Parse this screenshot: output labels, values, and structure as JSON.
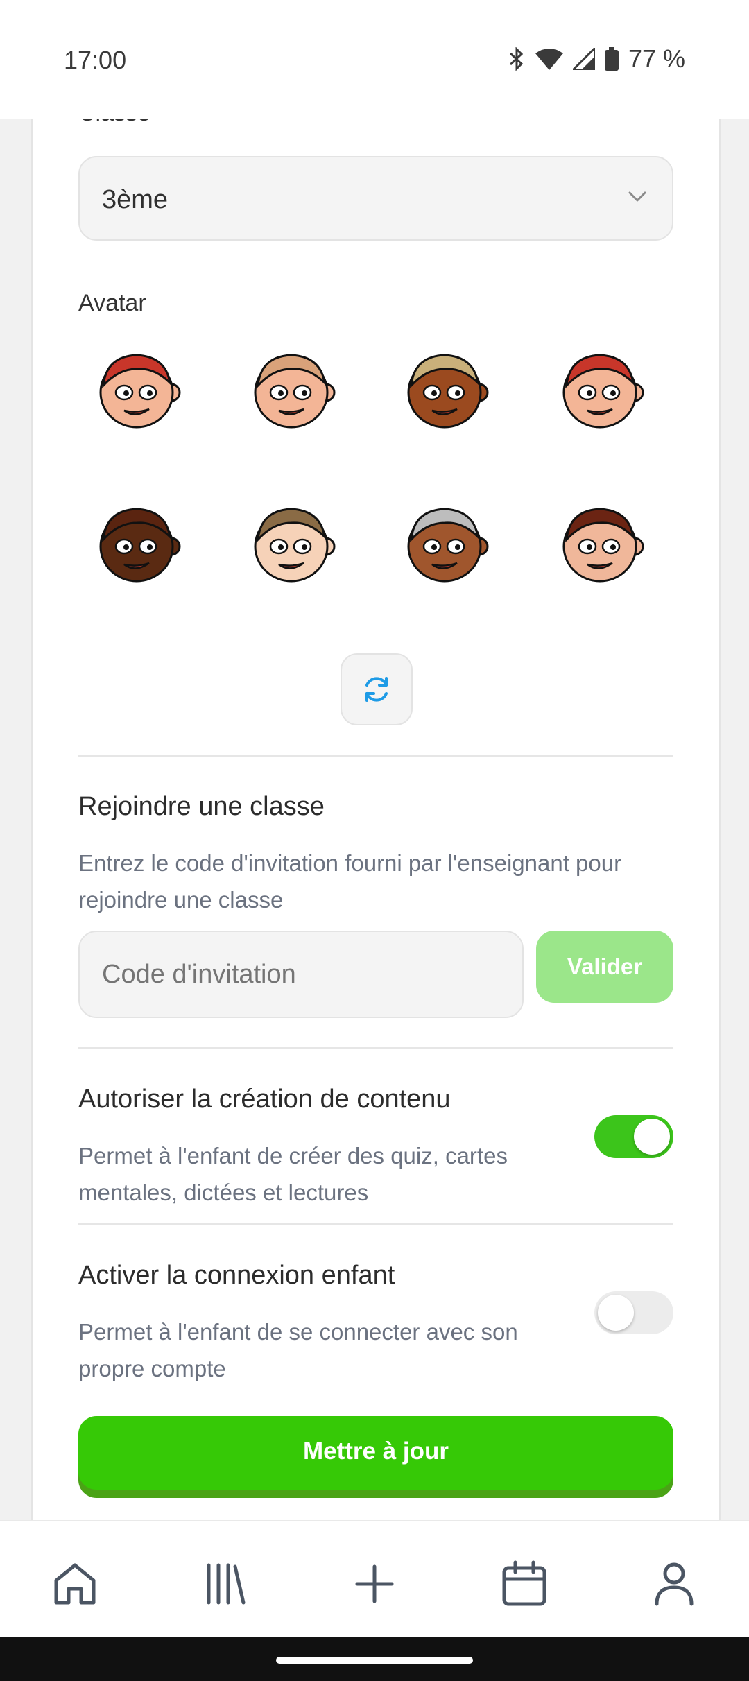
{
  "status_bar": {
    "time": "17:00",
    "battery": "77 %",
    "icons": [
      "bluetooth-icon",
      "wifi-icon",
      "signal-icon",
      "battery-icon"
    ]
  },
  "form": {
    "class_label": "Classe",
    "class_value": "3ème",
    "avatar_label": "Avatar",
    "avatars": [
      {
        "name": "avatar-red-hair-boy",
        "skin": "#f3b596",
        "hair": "#c8362a"
      },
      {
        "name": "avatar-bald-angry-boy",
        "skin": "#f3b596",
        "hair": "#d9a27a"
      },
      {
        "name": "avatar-blonde-dark-boy",
        "skin": "#9b4a1f",
        "hair": "#c9b07a"
      },
      {
        "name": "avatar-red-buns-girl",
        "skin": "#f3b596",
        "hair": "#c8362a"
      },
      {
        "name": "avatar-curly-dark-girl",
        "skin": "#5a2a12",
        "hair": "#5a2410"
      },
      {
        "name": "avatar-brown-hair-boy",
        "skin": "#f6d2b8",
        "hair": "#8a6b45"
      },
      {
        "name": "avatar-grey-hair-girl",
        "skin": "#a0562d",
        "hair": "#bdbdbd"
      },
      {
        "name": "avatar-brown-bob-girl",
        "skin": "#f0b79a",
        "hair": "#6b2413"
      }
    ],
    "refresh_icon": "refresh-icon"
  },
  "join_class": {
    "title": "Rejoindre une classe",
    "description": "Entrez le code d'invitation fourni par l'enseignant pour rejoindre une classe",
    "code_placeholder": "Code d'invitation",
    "validate_label": "Valider"
  },
  "settings": {
    "content_creation": {
      "title": "Autoriser la création de contenu",
      "description": "Permet à l'enfant de créer des quiz, cartes mentales, dictées et lectures",
      "enabled": true
    },
    "child_login": {
      "title": "Activer la connexion enfant",
      "description": "Permet à l'enfant de se connecter avec son propre compte",
      "enabled": false
    }
  },
  "update_label": "Mettre à jour",
  "bottom_nav": [
    "home-icon",
    "library-icon",
    "add-icon",
    "calendar-icon",
    "profile-icon"
  ],
  "colors": {
    "accent_green": "#36c906",
    "toggle_on": "#3cc51b",
    "validate_disabled": "#9be68a",
    "refresh_blue": "#1e9be6"
  }
}
